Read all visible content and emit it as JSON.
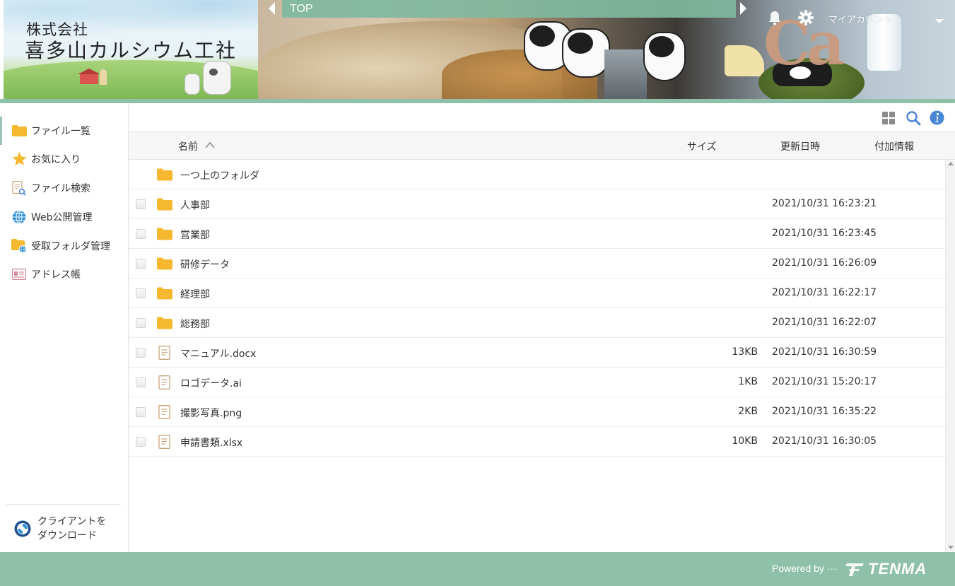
{
  "header": {
    "company_line1": "株式会社",
    "company_line2": "喜多山カルシウム工社",
    "banner_text": "Ca",
    "breadcrumb": "TOP",
    "account_label": "マイアカウント"
  },
  "sidebar": {
    "items": [
      {
        "label": "ファイル一覧",
        "icon": "folder-icon",
        "active": true
      },
      {
        "label": "お気に入り",
        "icon": "star-icon",
        "active": false
      },
      {
        "label": "ファイル検索",
        "icon": "file-search-icon",
        "active": false
      },
      {
        "label": "Web公開管理",
        "icon": "globe-icon",
        "active": false
      },
      {
        "label": "受取フォルダ管理",
        "icon": "folder-globe-icon",
        "active": false
      },
      {
        "label": "アドレス帳",
        "icon": "address-card-icon",
        "active": false
      }
    ],
    "download_line1": "クライアントを",
    "download_line2": "ダウンロード"
  },
  "table": {
    "col_name": "名前",
    "col_size": "サイズ",
    "col_updated": "更新日時",
    "col_extra": "付加情報",
    "parent_folder": "一つ上のフォルダ",
    "rows": [
      {
        "type": "folder",
        "name": "人事部",
        "size": "",
        "updated": "2021/10/31 16:23:21"
      },
      {
        "type": "folder",
        "name": "営業部",
        "size": "",
        "updated": "2021/10/31 16:23:45"
      },
      {
        "type": "folder",
        "name": "研修データ",
        "size": "",
        "updated": "2021/10/31 16:26:09"
      },
      {
        "type": "folder",
        "name": "経理部",
        "size": "",
        "updated": "2021/10/31 16:22:17"
      },
      {
        "type": "folder",
        "name": "総務部",
        "size": "",
        "updated": "2021/10/31 16:22:07"
      },
      {
        "type": "file",
        "name": "マニュアル.docx",
        "size": "13KB",
        "updated": "2021/10/31 16:30:59"
      },
      {
        "type": "file",
        "name": "ロゴデータ.ai",
        "size": "1KB",
        "updated": "2021/10/31 15:20:17"
      },
      {
        "type": "file",
        "name": "撮影写真.png",
        "size": "2KB",
        "updated": "2021/10/31 16:35:22"
      },
      {
        "type": "file",
        "name": "申請書類.xlsx",
        "size": "10KB",
        "updated": "2021/10/31 16:30:05"
      }
    ]
  },
  "footer": {
    "powered_by": "Powered by ···",
    "brand": "TENMA"
  },
  "colors": {
    "accent": "#8fc0a9",
    "folder": "#f5b82e",
    "info": "#4a86d6"
  }
}
